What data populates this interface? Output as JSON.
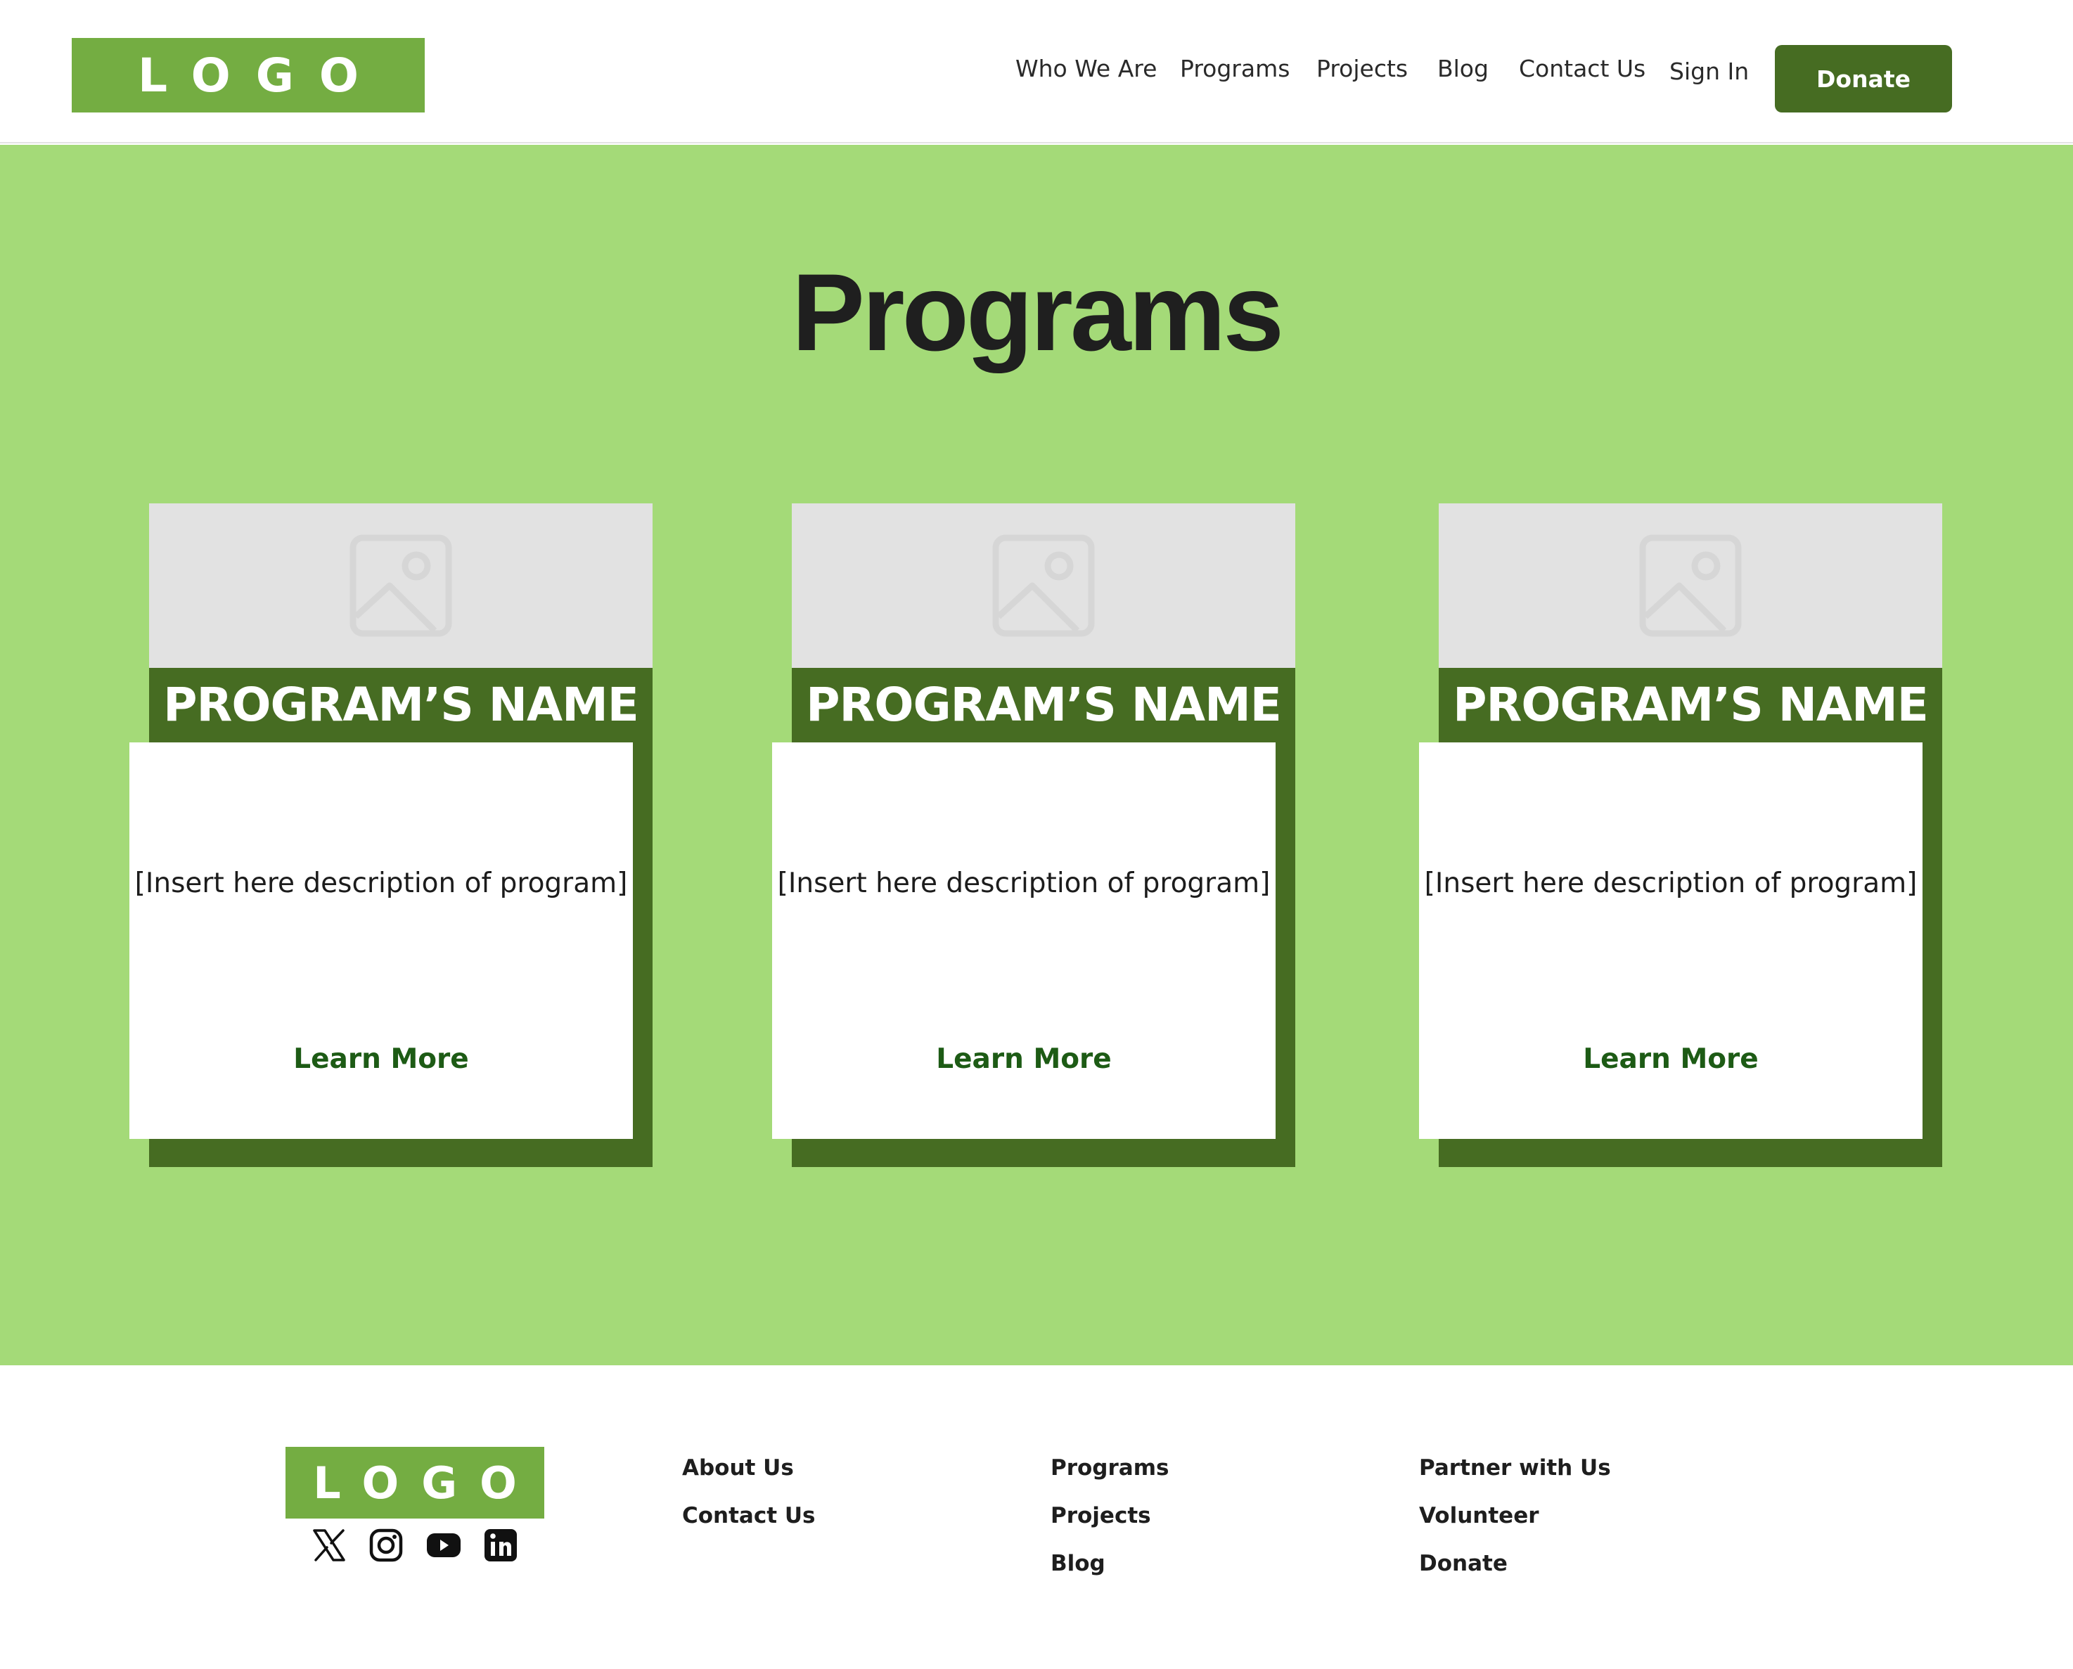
{
  "header": {
    "logo": "LOGO",
    "nav": [
      "Who We Are",
      "Programs",
      "Projects",
      "Blog",
      "Contact Us",
      "Sign In"
    ],
    "donate": "Donate"
  },
  "hero": {
    "title": "Programs",
    "cards": [
      {
        "image_icon": "image-placeholder-icon",
        "name": "PROGRAM’S NAME",
        "description": "[Insert here description of program]",
        "link": "Learn More"
      },
      {
        "image_icon": "image-placeholder-icon",
        "name": "PROGRAM’S NAME",
        "description": "[Insert here description of program]",
        "link": "Learn More"
      },
      {
        "image_icon": "image-placeholder-icon",
        "name": "PROGRAM’S NAME",
        "description": "[Insert here description of program]",
        "link": "Learn More"
      }
    ]
  },
  "footer": {
    "logo": "LOGO",
    "socials": [
      "x-icon",
      "instagram-icon",
      "youtube-icon",
      "linkedin-icon"
    ],
    "columns": [
      [
        "About Us",
        "Contact Us"
      ],
      [
        "Programs",
        "Projects",
        "Blog"
      ],
      [
        "Partner with Us",
        "Volunteer",
        "Donate"
      ]
    ]
  },
  "colors": {
    "brand_green": "#74ad42",
    "dark_green": "#466c22",
    "hero_bg": "#a4da78",
    "link_green": "#1d5b15"
  }
}
